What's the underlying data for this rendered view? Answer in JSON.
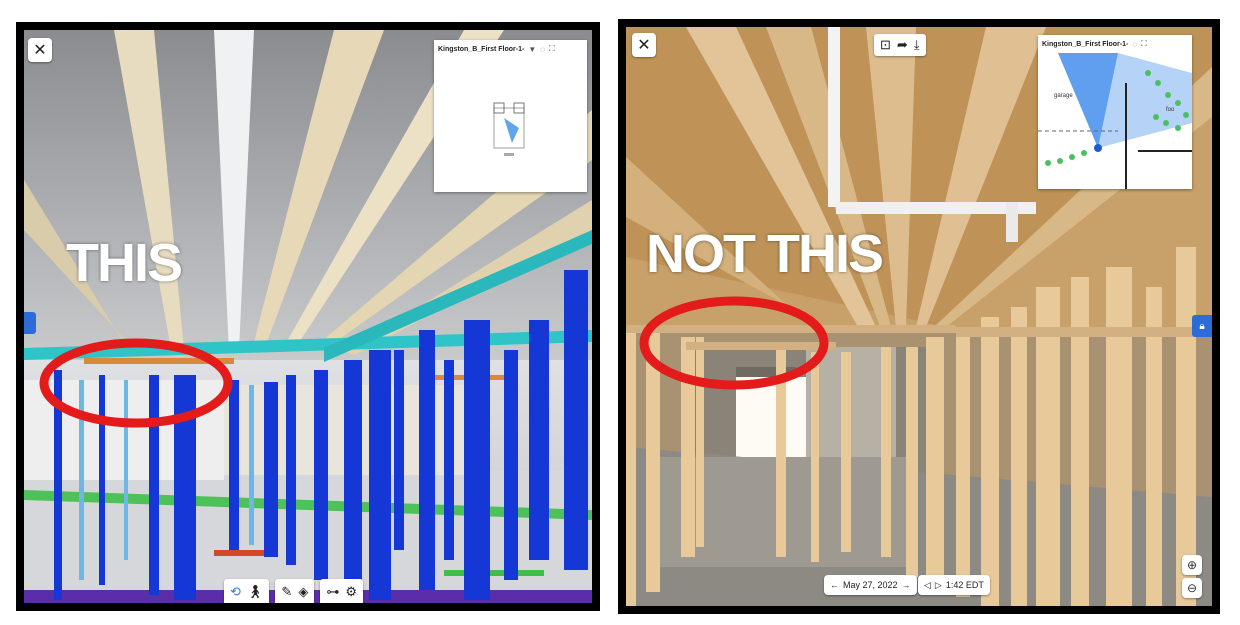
{
  "left_panel": {
    "caption": "THIS",
    "minimap": {
      "title": "Kingston_B_First Floor-1-",
      "dropdown_icon": "caret-down-icon",
      "expand_icon": "expand-icon"
    },
    "close_icon": "close-icon",
    "toolbar_icons": [
      "orbit-icon",
      "person-icon",
      "measure-icon",
      "section-box-icon",
      "hierarchy-icon",
      "settings-icon"
    ]
  },
  "right_panel": {
    "caption": "NOT THIS",
    "minimap": {
      "title": "Kingston_B_First Floor-1-",
      "room_garage": "garage",
      "room_other": "foo"
    },
    "close_icon": "close-icon",
    "date_nav": {
      "date": "May 27, 2022"
    },
    "time_nav": {
      "time": "1:42 EDT"
    },
    "zoom_in": "zoom-in-icon",
    "zoom_out": "zoom-out-icon"
  },
  "colors": {
    "highlight_circle": "#e31b1b",
    "blue_stud": "#1437d6",
    "cyan_beam": "#2ec4c8",
    "accent": "#2b6cd6"
  }
}
